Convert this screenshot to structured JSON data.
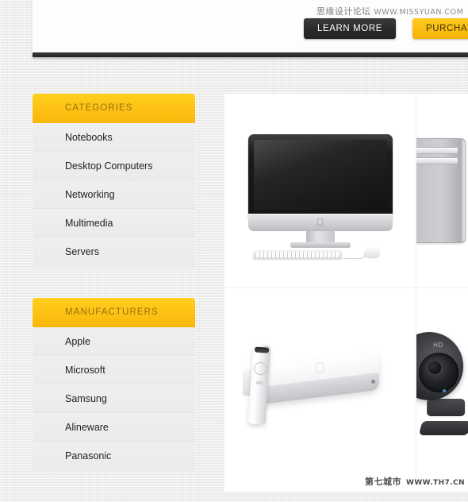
{
  "banner": {
    "learn_more_label": "LEARN MORE",
    "purchase_label": "PURCHASE",
    "colors": {
      "dark_button": "#2a2a2a",
      "yellow_button": "#fbbd10",
      "rule": "#2a2c30"
    }
  },
  "watermarks": {
    "top_text": "思缘设计论坛",
    "top_site": "WWW.MISSYUAN.COM",
    "bottom_text": "第七城市",
    "bottom_site": "WWW.TH7.CN"
  },
  "sidebar": {
    "accent_color": "#fdc215",
    "header_text_color": "#96710f",
    "blocks": [
      {
        "title": "CATEGORIES",
        "items": [
          {
            "label": "Notebooks"
          },
          {
            "label": "Desktop Computers"
          },
          {
            "label": "Networking"
          },
          {
            "label": "Multimedia"
          },
          {
            "label": "Servers"
          }
        ]
      },
      {
        "title": "MANUFACTURERS",
        "items": [
          {
            "label": "Apple"
          },
          {
            "label": "Microsoft"
          },
          {
            "label": "Samsung"
          },
          {
            "label": "Alineware"
          },
          {
            "label": "Panasonic"
          }
        ]
      }
    ]
  },
  "products": {
    "rows": [
      {
        "cells": [
          {
            "name": "imac-all-in-one-desktop",
            "icon": "imac-icon",
            "logo": "",
            "clipped": false
          },
          {
            "name": "mac-pro-tower-desktop",
            "icon": "tower-icon",
            "clipped": true
          }
        ]
      },
      {
        "cells": [
          {
            "name": "apple-tv-with-remote",
            "icon": "apple-tv-icon",
            "logo": "",
            "clipped": false
          },
          {
            "name": "hd-webcam",
            "icon": "webcam-icon",
            "badge": "HD",
            "clipped": true
          }
        ]
      }
    ]
  }
}
